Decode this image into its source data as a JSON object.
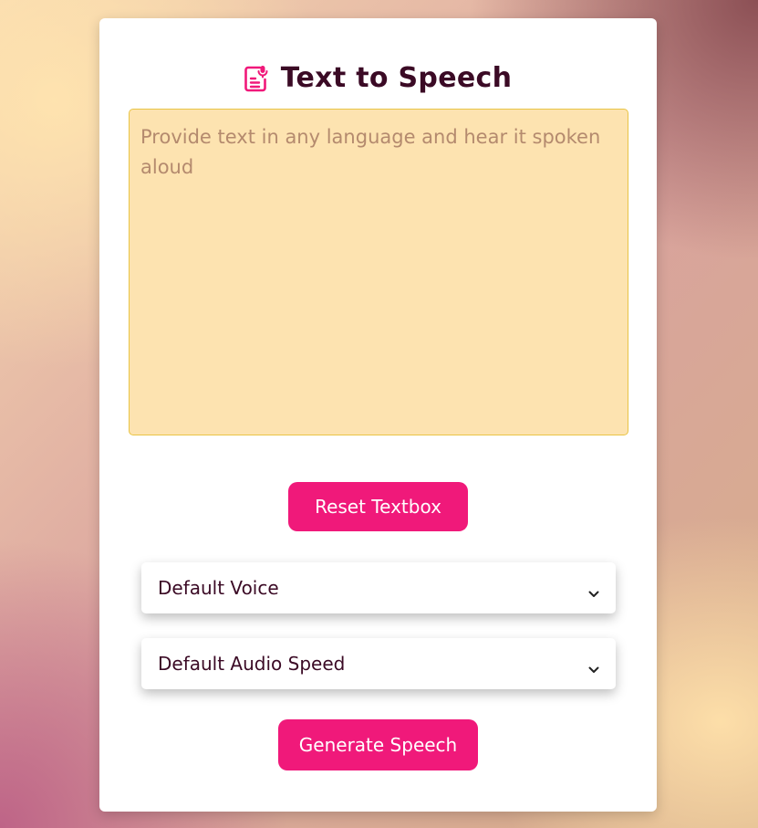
{
  "app": {
    "title": "Text to Speech",
    "title_icon": "document-mic-icon"
  },
  "textbox": {
    "placeholder": "Provide text in any language and hear it spoken aloud",
    "value": ""
  },
  "buttons": {
    "reset_label": "Reset Textbox",
    "generate_label": "Generate Speech"
  },
  "selects": {
    "voice": {
      "selected": "Default Voice",
      "icon": "chevron-down-icon"
    },
    "speed": {
      "selected": "Default Audio Speed",
      "icon": "chevron-down-icon"
    }
  },
  "colors": {
    "accent": "#f0197a",
    "title": "#3b0a25",
    "textbox_bg": "#fde3b0",
    "textbox_border": "#e9c445"
  }
}
